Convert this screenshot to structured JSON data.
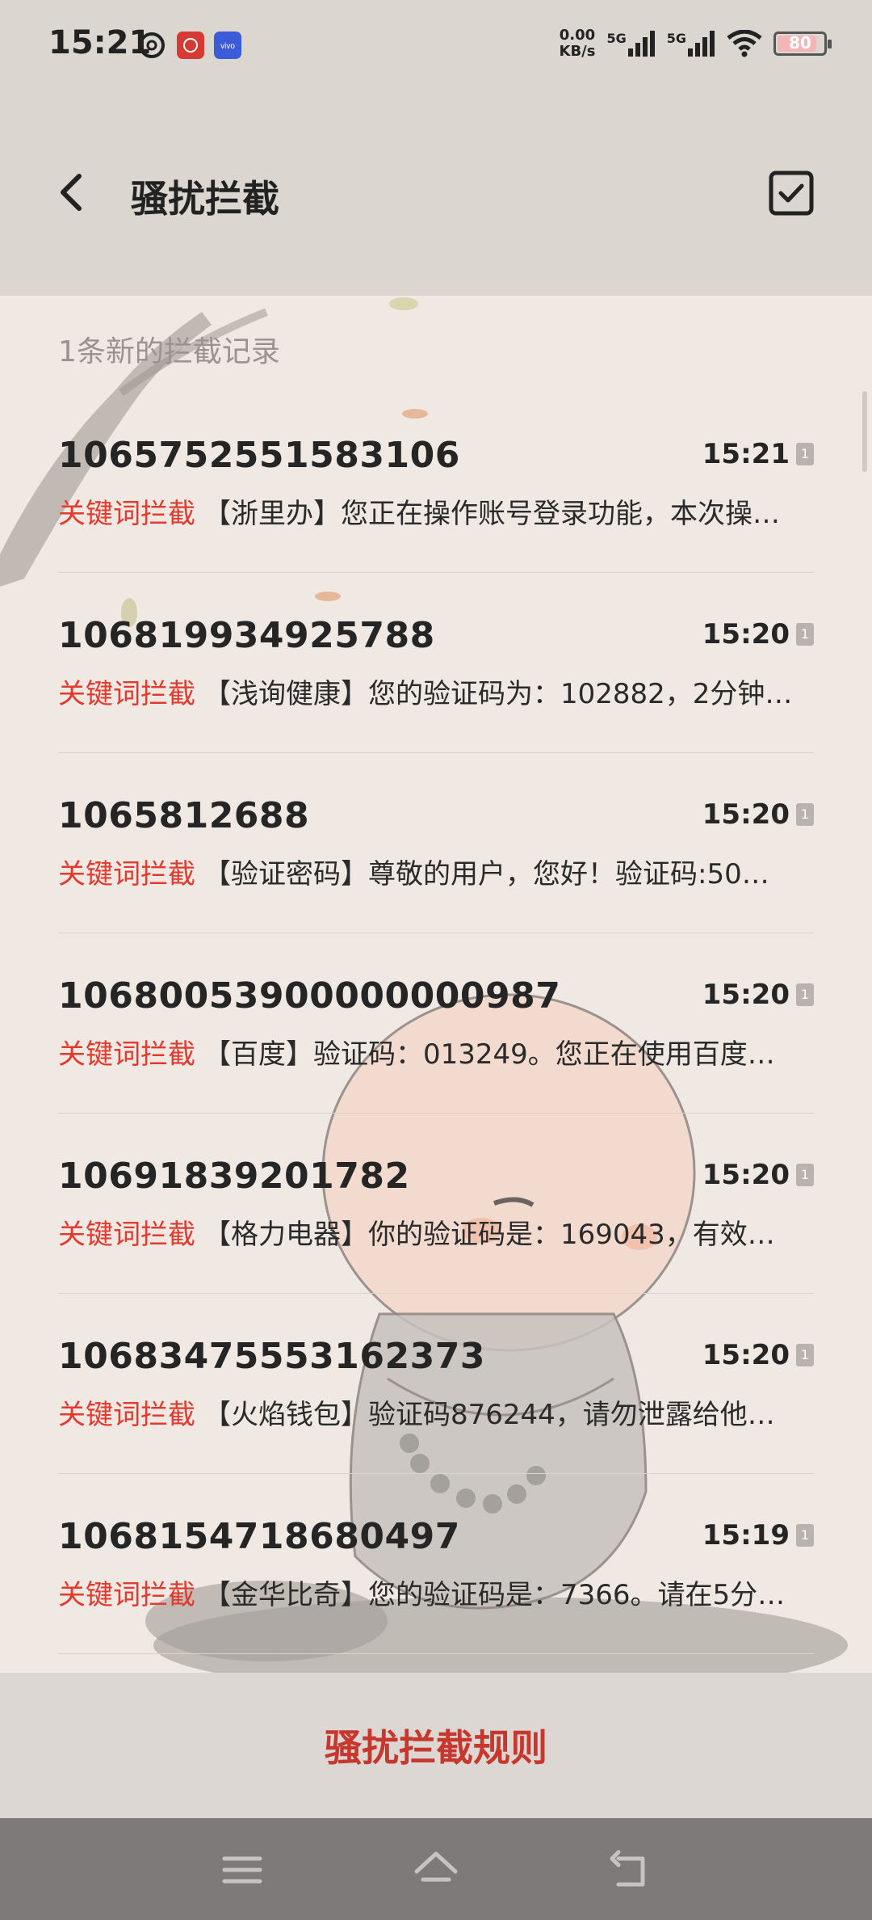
{
  "status_bar": {
    "time": "15:21",
    "speed_value": "0.00",
    "speed_unit": "KB/s",
    "sim1": "5G",
    "sim2": "5G",
    "battery": "80",
    "icons": [
      "netease-music-icon",
      "app-red-icon",
      "vivo-icon",
      "signal-icon",
      "wifi-icon",
      "battery-icon"
    ]
  },
  "header": {
    "title": "骚扰拦截"
  },
  "section_label": "1条新的拦截记录",
  "messages": [
    {
      "number": "1065752551583106",
      "time": "15:21",
      "tag": "关键词拦截",
      "preview": "【浙里办】您正在操作账号登录功能，本次操…"
    },
    {
      "number": "106819934925788",
      "time": "15:20",
      "tag": "关键词拦截",
      "preview": "【浅询健康】您的验证码为：102882，2分钟…"
    },
    {
      "number": "1065812688",
      "time": "15:20",
      "tag": "关键词拦截",
      "preview": "【验证密码】尊敬的用户，您好！验证码:50…"
    },
    {
      "number": "10680053900000000987",
      "time": "15:20",
      "tag": "关键词拦截",
      "preview": "【百度】验证码：013249。您正在使用百度…"
    },
    {
      "number": "10691839201782",
      "time": "15:20",
      "tag": "关键词拦截",
      "preview": "【格力电器】你的验证码是：169043，有效…"
    },
    {
      "number": "10683475553162373",
      "time": "15:20",
      "tag": "关键词拦截",
      "preview": "【火焰钱包】验证码876244，请勿泄露给他…"
    },
    {
      "number": "1068154718680497",
      "time": "15:19",
      "tag": "关键词拦截",
      "preview": "【金华比奇】您的验证码是：7366。请在5分…"
    }
  ],
  "sim_badge": "1",
  "bottom": {
    "rules_label": "骚扰拦截规则"
  },
  "colors": {
    "accent_red": "#e23a2e",
    "rules_red": "#c7372e",
    "header_bg": "#dcd6d1",
    "content_bg": "#efe8e3"
  }
}
